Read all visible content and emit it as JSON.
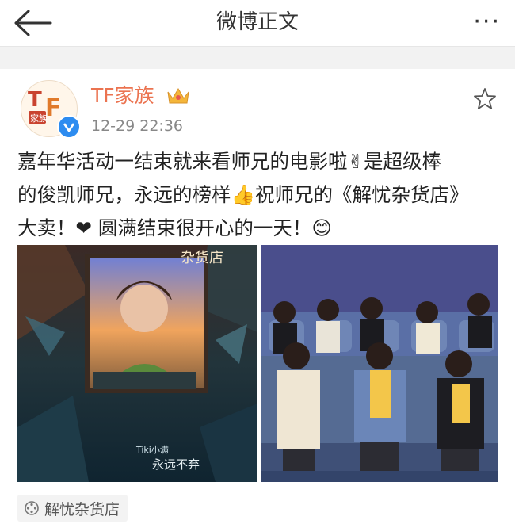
{
  "header": {
    "title": "微博正文",
    "more_label": "···"
  },
  "post": {
    "avatar_text": "TF家族",
    "username": "TF家族",
    "timestamp": "12-29 22:36",
    "text_lines": [
      "嘉年华活动一结束就来看师兄的电影啦✌是超级棒",
      "的俊凯师兄，永远的榜样👍祝师兄的《解忧杂货店》",
      "大卖！❤ 圆满结束很开心的一天！😊"
    ],
    "poster_title": "杂货店",
    "poster_signature": "永远不弃",
    "poster_caption": "Tiki小满",
    "location_tag": "解忧杂货店"
  },
  "colors": {
    "accent": "#eb7350",
    "verified": "#2d8cf0",
    "divider": "#f2f2f2"
  }
}
